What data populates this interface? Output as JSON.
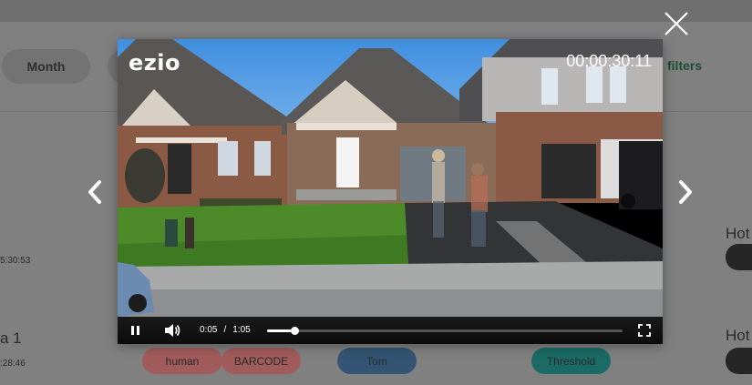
{
  "background": {
    "month_chip": "Month",
    "filters_link": "filters",
    "time_1": "5:30:53",
    "title_2": "a 1",
    "time_2": ":28:46",
    "hot_1": "Hot",
    "hot_2": "Hot",
    "tags": {
      "human": "human",
      "barcode": "BARCODE",
      "tom": "Tom",
      "threshold": "Threshold"
    }
  },
  "player": {
    "watermark": "ezio",
    "timestamp": "00:00:30:11",
    "current_time": "0:05",
    "separator": "/",
    "duration": "1:05",
    "progress_fraction": 0.077
  },
  "colors": {
    "dim_overlay": "#808080",
    "tag_red": "#a15b5b",
    "tag_blue": "#335573",
    "tag_teal": "#1b6a66",
    "filters_green": "#1a4d3a"
  },
  "icons": {
    "close": "close-icon",
    "prev": "chevron-left-icon",
    "next": "chevron-right-icon",
    "pause": "pause-icon",
    "volume": "volume-icon",
    "fullscreen": "fullscreen-icon"
  }
}
